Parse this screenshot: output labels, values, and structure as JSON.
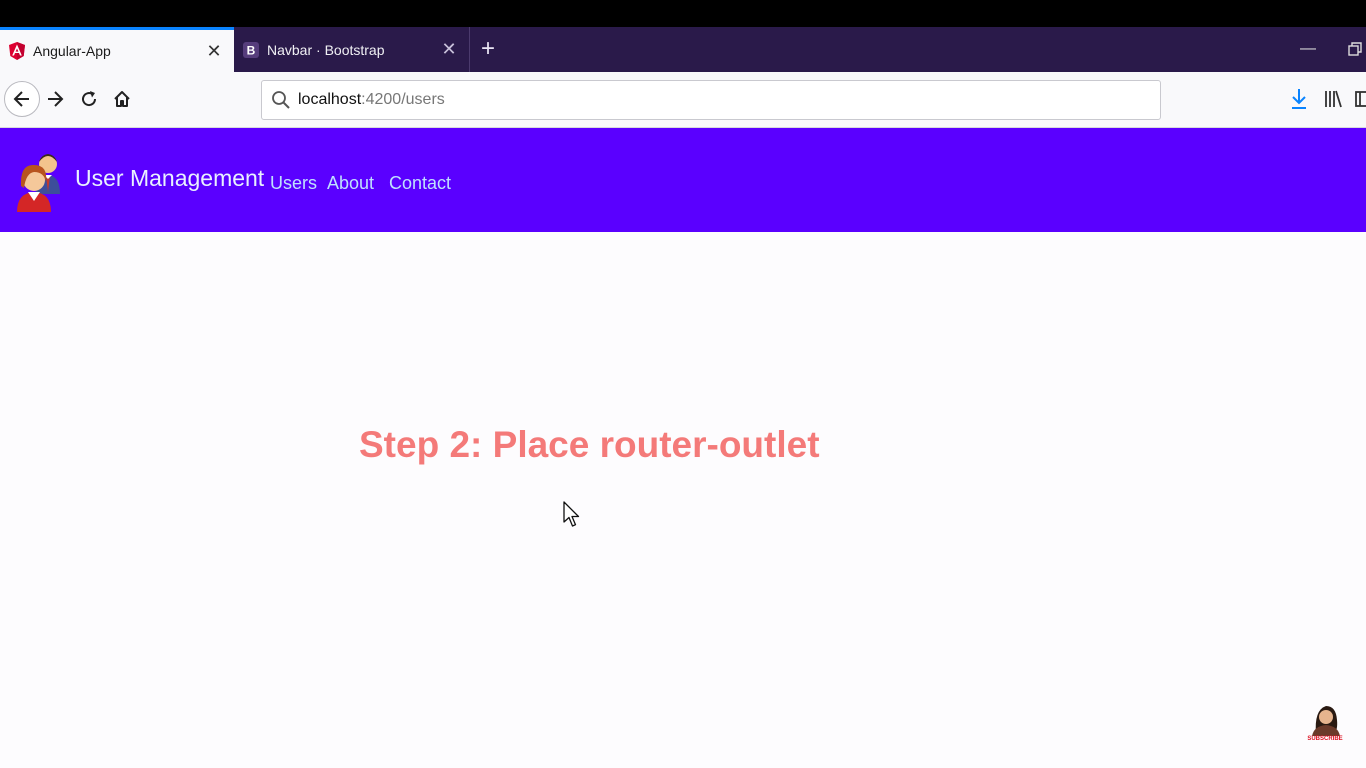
{
  "browser": {
    "tabs": [
      {
        "title": "Angular-App",
        "favicon": "angular-icon",
        "active": true
      },
      {
        "title": "Navbar · Bootstrap",
        "favicon": "bootstrap-icon",
        "active": false
      }
    ],
    "url": {
      "host": "localhost",
      "path": ":4200/users"
    }
  },
  "app": {
    "brand": "User Management",
    "nav": [
      {
        "label": "Users"
      },
      {
        "label": "About"
      },
      {
        "label": "Contact"
      }
    ],
    "accent_color": "#5a00ff"
  },
  "content": {
    "headline": "Step 2: Place router-outlet",
    "headline_color": "#f47a79"
  },
  "overlay": {
    "subscribe_label": "SUBSCRIBE"
  }
}
